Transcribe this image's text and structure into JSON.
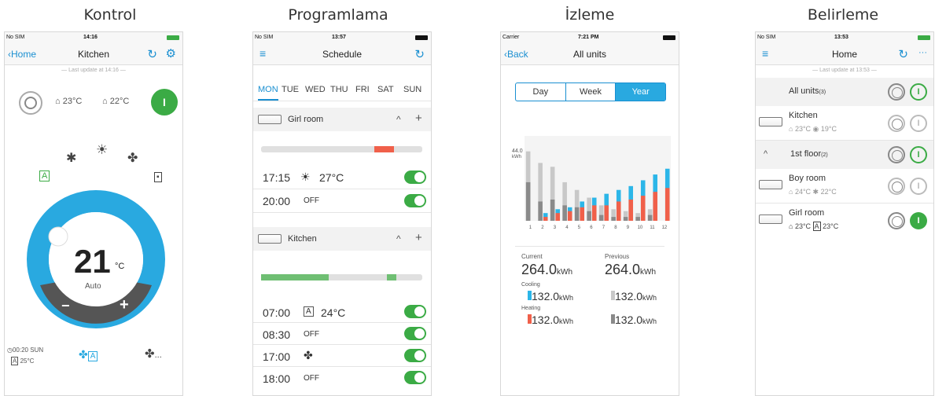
{
  "captions": [
    "Kontrol",
    "Programlama",
    "İzleme",
    "Belirleme"
  ],
  "colors": {
    "accent": "#1a8fd1",
    "ring": "#29a9e0",
    "green": "#3bab45",
    "heating": "#f0604a",
    "cooling": "#2cb6e8"
  },
  "control": {
    "status_left": "No SIM",
    "status_time": "14:16",
    "back": "Home",
    "title": "Kitchen",
    "last_update": "— Last update at 14:16 —",
    "indoor_temp": "23°C",
    "outdoor_temp": "22°C",
    "mode_auto": "A",
    "setpoint": "21",
    "unit": "°C",
    "mode_label": "Auto",
    "minus": "−",
    "plus": "+",
    "timer": "00:20 SUN",
    "timer_mode": "A",
    "timer_temp": "25°C",
    "fan_mode": "A",
    "more": "..."
  },
  "schedule": {
    "status_left": "No SIM",
    "status_time": "13:57",
    "title": "Schedule",
    "days": [
      "MON",
      "TUE",
      "WED",
      "THU",
      "FRI",
      "SAT",
      "SUN"
    ],
    "unit1": "Girl room",
    "unit1_entries": [
      {
        "time": "17:15",
        "value": "27°C"
      },
      {
        "time": "20:00",
        "value": "OFF"
      }
    ],
    "unit2": "Kitchen",
    "unit2_entries": [
      {
        "time": "07:00",
        "mode": "A",
        "value": "24°C"
      },
      {
        "time": "08:30",
        "value": "OFF"
      },
      {
        "time": "17:00",
        "value": ""
      },
      {
        "time": "18:00",
        "value": "OFF"
      }
    ],
    "caret": "^",
    "add": "+"
  },
  "monitor": {
    "status_left": "Carrier",
    "status_time": "7:21 PM",
    "back": "Back",
    "title": "All units",
    "tabs": [
      "Day",
      "Week",
      "Year"
    ],
    "y_label_value": "44.0",
    "y_label_unit": "kWh",
    "current_label": "Current",
    "previous_label": "Previous",
    "current_value": "264.0",
    "previous_value": "264.0",
    "kwh": "kWh",
    "cooling_label": "Cooling",
    "heating_label": "Heating",
    "cooling_current": "132.0",
    "cooling_previous": "132.0",
    "heating_current": "132.0",
    "heating_previous": "132.0"
  },
  "chart_data": {
    "type": "bar",
    "categories": [
      "1",
      "2",
      "3",
      "4",
      "5",
      "6",
      "7",
      "8",
      "9",
      "10",
      "11",
      "12"
    ],
    "ylim": [
      0,
      44
    ],
    "series": [
      {
        "values": [
          36,
          30,
          28,
          20,
          16,
          12,
          8,
          6,
          5,
          4,
          6,
          0
        ]
      },
      {
        "values": [
          20,
          10,
          11,
          8,
          7,
          5,
          3,
          2,
          2,
          2,
          3,
          0
        ]
      },
      {
        "values": [
          0,
          2,
          4,
          5,
          7,
          8,
          8,
          10,
          11,
          13,
          15,
          17
        ]
      },
      {
        "values": [
          0,
          4,
          6,
          7,
          10,
          12,
          14,
          16,
          18,
          21,
          24,
          27
        ]
      }
    ]
  },
  "locate": {
    "status_left": "No SIM",
    "status_time": "13:53",
    "title": "Home",
    "last_update": "— Last update at 13:53 —",
    "all_units": "All units",
    "all_units_count": "(3)",
    "kitchen": "Kitchen",
    "kitchen_t1": "23°C",
    "kitchen_t2": "19°C",
    "floor": "1st floor",
    "floor_count": "(2)",
    "boy_room": "Boy room",
    "boy_t1": "24°C",
    "boy_t2": "22°C",
    "girl_room": "Girl room",
    "girl_t1": "23°C",
    "girl_mode": "A",
    "girl_t2": "23°C",
    "more": "···"
  }
}
